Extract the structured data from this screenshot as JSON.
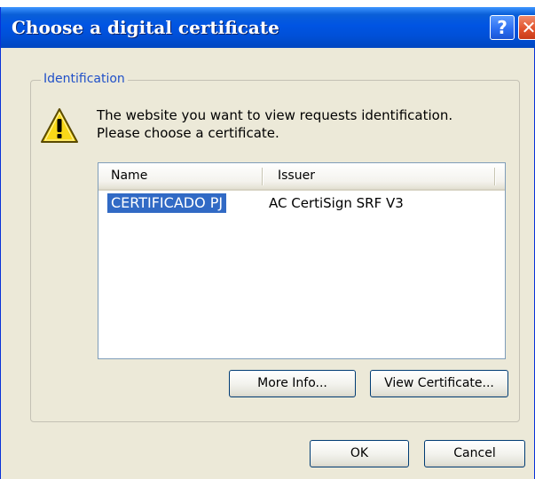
{
  "window": {
    "title": "Choose a digital certificate",
    "help_label": "?",
    "close_label": "✕"
  },
  "group": {
    "label": "Identification"
  },
  "message": {
    "line1": "The website you want to view requests identification.",
    "line2": "Please choose a certificate."
  },
  "list": {
    "columns": [
      "Name",
      "Issuer"
    ],
    "rows": [
      {
        "name": "CERTIFICADO PJ",
        "issuer": "AC CertiSign SRF V3",
        "selected": true
      }
    ]
  },
  "buttons": {
    "more_info": "More Info...",
    "view_certificate": "View Certificate...",
    "ok": "OK",
    "cancel": "Cancel"
  },
  "icons": {
    "warning": "warning-icon"
  },
  "colors": {
    "titlebar": "#0054e3",
    "selection": "#316ac5",
    "dialog_bg": "#ece9d8"
  }
}
